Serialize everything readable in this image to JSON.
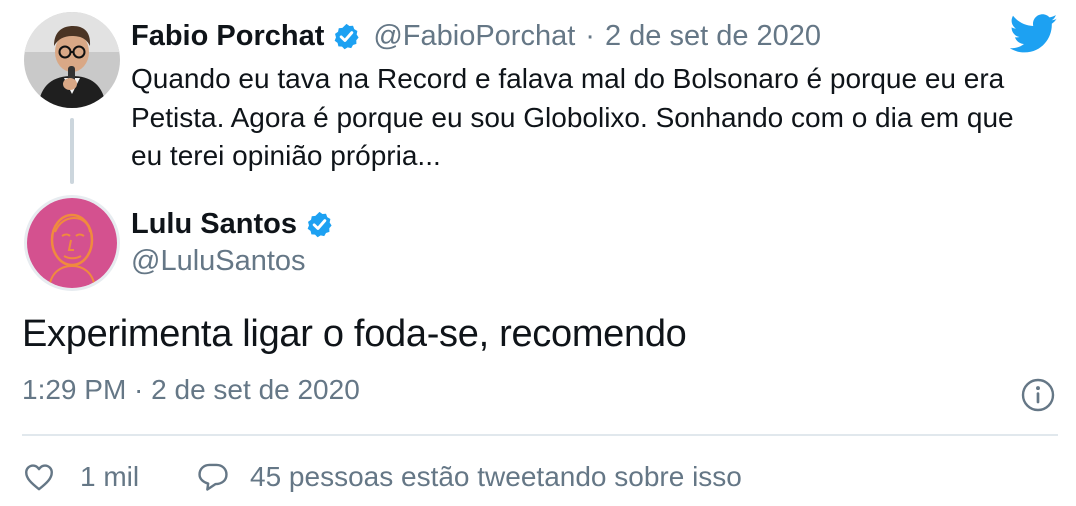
{
  "quoted_tweet": {
    "author_name": "Fabio Porchat",
    "handle": "@FabioPorchat",
    "separator": "·",
    "date": "2 de set de 2020",
    "text": "Quando eu tava na Record e falava mal do Bolsonaro é porque eu era Petista. Agora é porque eu sou Globolixo. Sonhando com o dia em que eu terei opinião própria..."
  },
  "reply_tweet": {
    "author_name": "Lulu Santos",
    "handle": "@LuluSantos",
    "text": "Experimenta ligar o foda-se, recomendo",
    "meta": "1:29 PM · 2 de set de 2020"
  },
  "actions": {
    "likes_label": "1 mil",
    "conversation_label": "45 pessoas estão tweetando sobre isso"
  },
  "icons": {
    "verified": "verified-badge-icon",
    "brand": "twitter-bird-icon",
    "info": "info-icon",
    "like": "heart-icon",
    "conversation": "speech-bubble-icon"
  },
  "colors": {
    "brand_blue": "#1da1f2",
    "muted_text": "#657786",
    "primary_text": "#0f1419",
    "avatar_pink": "#d4518f"
  }
}
